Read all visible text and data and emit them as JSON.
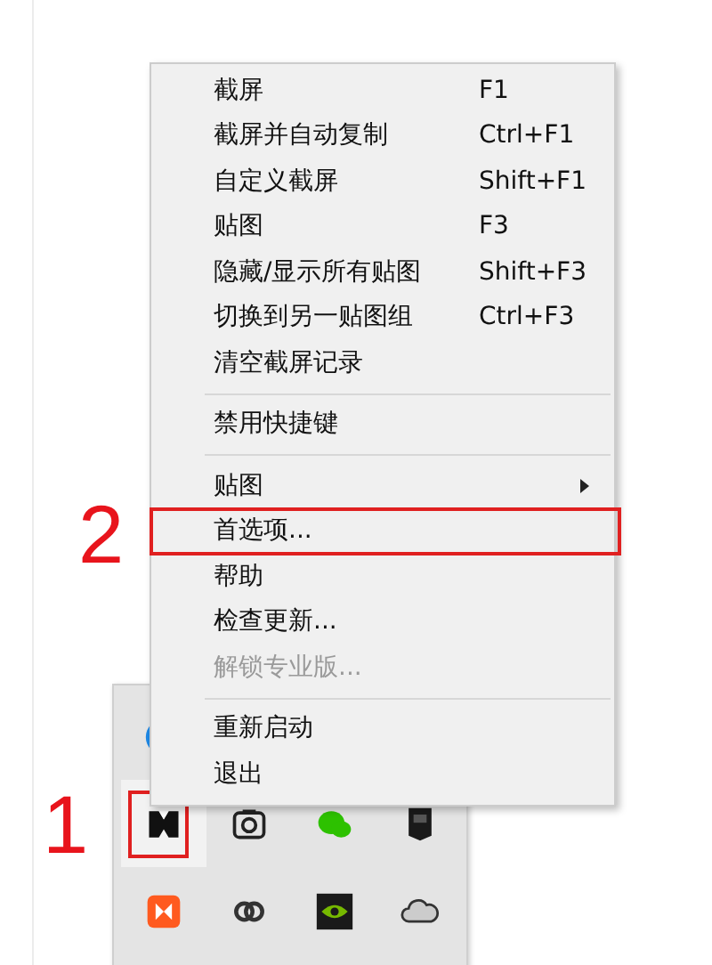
{
  "menu": {
    "items": [
      {
        "kind": "item",
        "label": "截屏",
        "shortcut": "F1",
        "disabled": false
      },
      {
        "kind": "item",
        "label": "截屏并自动复制",
        "shortcut": "Ctrl+F1",
        "disabled": false
      },
      {
        "kind": "item",
        "label": "自定义截屏",
        "shortcut": "Shift+F1",
        "disabled": false
      },
      {
        "kind": "item",
        "label": "贴图",
        "shortcut": "F3",
        "disabled": false
      },
      {
        "kind": "item",
        "label": "隐藏/显示所有贴图",
        "shortcut": "Shift+F3",
        "disabled": false
      },
      {
        "kind": "item",
        "label": "切换到另一贴图组",
        "shortcut": "Ctrl+F3",
        "disabled": false
      },
      {
        "kind": "item",
        "label": "清空截屏记录",
        "disabled": false
      },
      {
        "kind": "separator"
      },
      {
        "kind": "item",
        "label": "禁用快捷键",
        "disabled": false
      },
      {
        "kind": "separator"
      },
      {
        "kind": "submenu",
        "label": "贴图",
        "disabled": false
      },
      {
        "kind": "item",
        "label": "首选项...",
        "disabled": false,
        "callout": "2"
      },
      {
        "kind": "item",
        "label": "帮助",
        "disabled": false
      },
      {
        "kind": "item",
        "label": "检查更新...",
        "disabled": false
      },
      {
        "kind": "item",
        "label": "解锁专业版...",
        "disabled": true
      },
      {
        "kind": "separator"
      },
      {
        "kind": "item",
        "label": "重新启动",
        "disabled": false
      },
      {
        "kind": "item",
        "label": "退出",
        "disabled": false
      }
    ]
  },
  "tray": {
    "icons": [
      {
        "selected": false
      },
      {
        "selected": true,
        "callout": "1"
      },
      {
        "selected": false
      },
      {
        "selected": false
      },
      {
        "selected": false
      },
      {
        "selected": false
      },
      {
        "selected": false
      },
      {
        "selected": false
      },
      {
        "selected": false
      }
    ]
  }
}
